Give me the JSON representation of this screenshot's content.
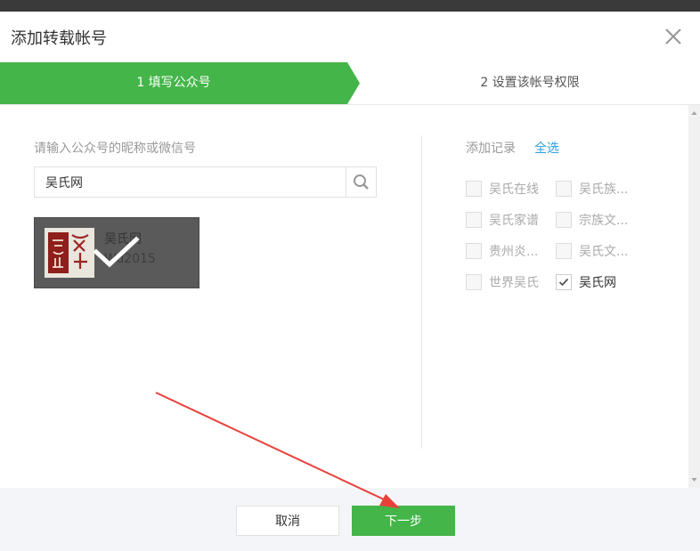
{
  "dialog": {
    "title": "添加转载帐号"
  },
  "steps": [
    {
      "label": "1 填写公众号"
    },
    {
      "label": "2 设置该帐号权限"
    }
  ],
  "search": {
    "hint": "请输入公众号的昵称或微信号",
    "value": "吴氏网"
  },
  "result": {
    "name": "吴氏网",
    "id": "Wu2015",
    "selected": true
  },
  "records": {
    "title": "添加记录",
    "select_all": "全选",
    "items": [
      {
        "label": "吴氏在线",
        "checked": false
      },
      {
        "label": "吴氏族...",
        "checked": false
      },
      {
        "label": "吴氏家谱",
        "checked": false
      },
      {
        "label": "宗族文...",
        "checked": false
      },
      {
        "label": "贵州炎...",
        "checked": false
      },
      {
        "label": "吴氏文...",
        "checked": false
      },
      {
        "label": "世界吴氏",
        "checked": false
      },
      {
        "label": "吴氏网",
        "checked": true
      }
    ]
  },
  "footer": {
    "cancel_label": "取消",
    "next_label": "下一步"
  },
  "colors": {
    "accent": "#44b549",
    "link": "#2c9fe2",
    "annotation_arrow": "#e8403b"
  }
}
